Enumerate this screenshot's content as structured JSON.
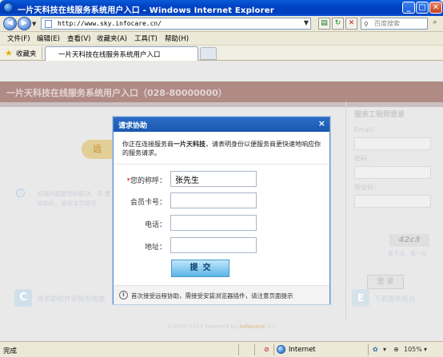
{
  "window": {
    "title": "一片天科技在线服务系统用户入口 - Windows Internet Explorer",
    "min_label": "_",
    "max_label": "□",
    "close_label": "✕"
  },
  "navbar": {
    "url": "http://www.sky.infocare.cn/",
    "search_placeholder": "百度搜索"
  },
  "menu": [
    "文件(F)",
    "编辑(E)",
    "查看(V)",
    "收藏夹(A)",
    "工具(T)",
    "帮助(H)"
  ],
  "favorites_label": "收藏夹",
  "tab": {
    "label": "一片天科技在线服务系统用户入口"
  },
  "page": {
    "site_title": "一片天科技在线服务系统用户入口（028-80000000）",
    "remote_button": "远",
    "info_text": "如遇问题要协助解决，请 要协助的，请按本页提示",
    "engineer_login": {
      "title": "服务工程师登录",
      "email_label": "Email：",
      "password_label": "密码：",
      "captcha_label": "验证码：",
      "captcha_value": "42c3",
      "captcha_hint": "看不清，换一张",
      "login_button": "登 录"
    },
    "bottom_left": "将求助软件安装到电脑",
    "bottom_right": "下载服务助台",
    "footer_prefix": "©2007-2017 Powered by",
    "footer_brand": "infocare",
    "footer_suffix": "2.0"
  },
  "modal": {
    "title": "请求协助",
    "close": "×",
    "intro_prefix": "你正在连接服务商",
    "intro_company": "一片天科技",
    "intro_suffix": "，请表明身份以便服务商更快速地响应你的服务请求。",
    "fields": [
      {
        "label": "您的称呼：",
        "required": true,
        "value": "张先生"
      },
      {
        "label": "会员卡号：",
        "required": false,
        "value": ""
      },
      {
        "label": "电话：",
        "required": false,
        "value": ""
      },
      {
        "label": "地址：",
        "required": false,
        "value": ""
      }
    ],
    "required_mark": "*",
    "submit_label": "提交",
    "footer_text": "首次接受远程协助，需接受安装浏览器插件，请注意页面提示"
  },
  "statusbar": {
    "status": "完成",
    "zone": "Internet",
    "zoom": "105%"
  }
}
